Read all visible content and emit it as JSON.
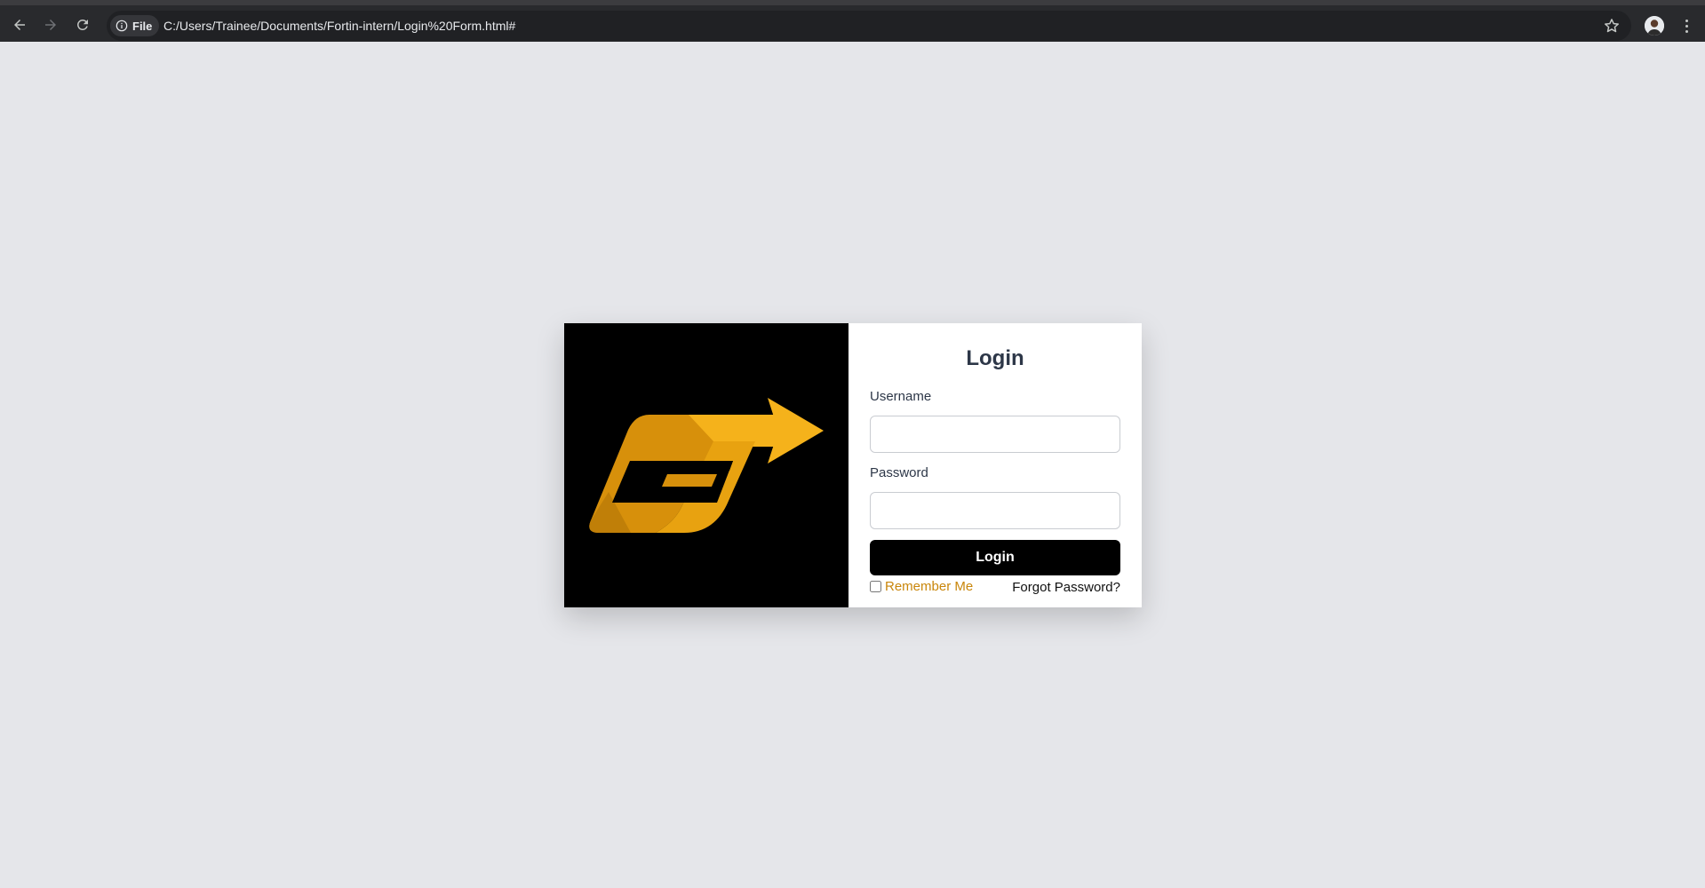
{
  "browser": {
    "site_chip_label": "File",
    "url": "C:/Users/Trainee/Documents/Fortin-intern/Login%20Form.html#",
    "icons": [
      "back-arrow-icon",
      "forward-arrow-icon",
      "reload-icon",
      "info-icon",
      "star-icon",
      "profile-avatar",
      "kebab-menu-icon"
    ]
  },
  "login": {
    "title": "Login",
    "username_label": "Username",
    "username_value": "",
    "password_label": "Password",
    "password_value": "",
    "submit_label": "Login",
    "remember_label": "Remember Me",
    "remember_checked": false,
    "forgot_label": "Forgot Password?"
  },
  "colors": {
    "page_background": "#e5e6ea",
    "logo_background": "#000000",
    "logo_gold": "#f5b21b",
    "accent": "#c9860a",
    "button": "#000000"
  }
}
